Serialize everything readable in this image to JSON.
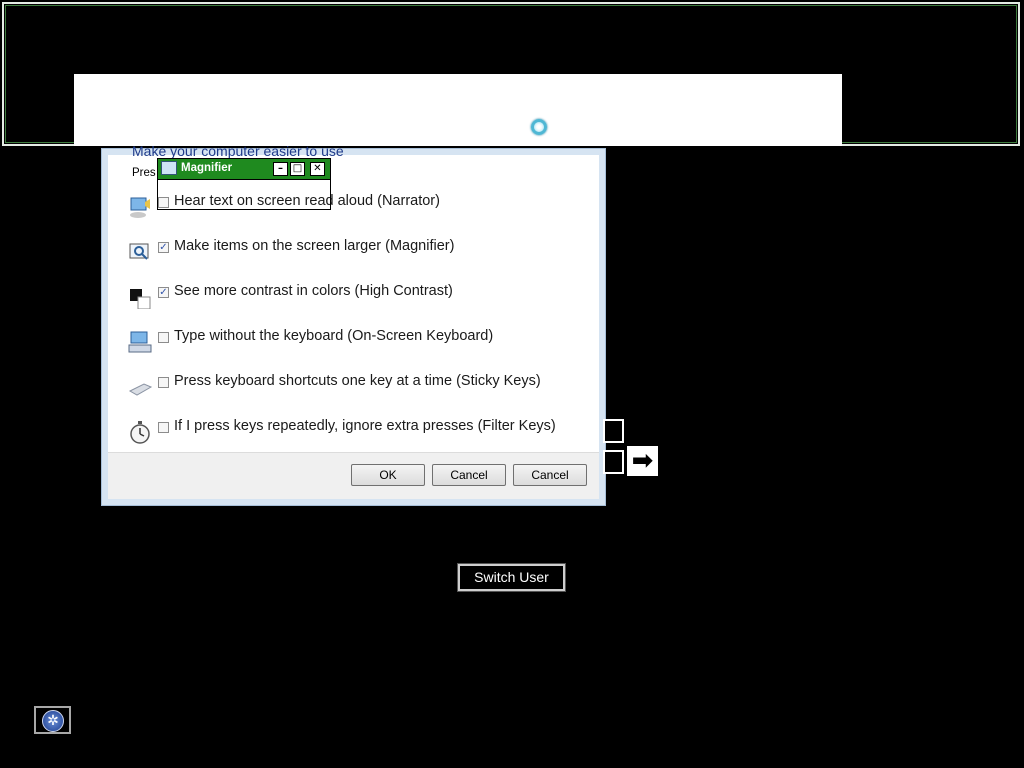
{
  "magnifier": {
    "title": "Magnifier",
    "minimize_icon": "minimize-icon",
    "maximize_icon": "maximize-icon",
    "close_icon": "close-icon",
    "min_glyph": "–",
    "max_glyph": "□",
    "close_glyph": "✕"
  },
  "dialog": {
    "heading": "Make your computer easier to use",
    "instruction": "Pres                                   lighted option.",
    "options": [
      {
        "label": "Hear text on screen read aloud (Narrator)",
        "checked": false,
        "icon": "narrator-icon"
      },
      {
        "label": "Make items on the screen larger (Magnifier)",
        "checked": true,
        "icon": "magnifier-icon"
      },
      {
        "label": "See more contrast in colors (High Contrast)",
        "checked": true,
        "icon": "high-contrast-icon"
      },
      {
        "label": "Type without the keyboard (On-Screen Keyboard)",
        "checked": false,
        "icon": "keyboard-icon"
      },
      {
        "label": "Press keyboard shortcuts one key at a time (Sticky Keys)",
        "checked": false,
        "icon": "sticky-keys-icon"
      },
      {
        "label": "If I press keys repeatedly, ignore extra presses (Filter Keys)",
        "checked": false,
        "icon": "filter-keys-icon"
      }
    ],
    "buttons": {
      "ok": "OK",
      "cancel1": "Cancel",
      "cancel2": "Cancel"
    }
  },
  "logon": {
    "switch_user": "Switch User",
    "arrow_glyph": "➡",
    "ease_glyph": "✲"
  },
  "colors": {
    "magnifier_bar": "#1f8a1f",
    "heading": "#1e3a8a"
  }
}
